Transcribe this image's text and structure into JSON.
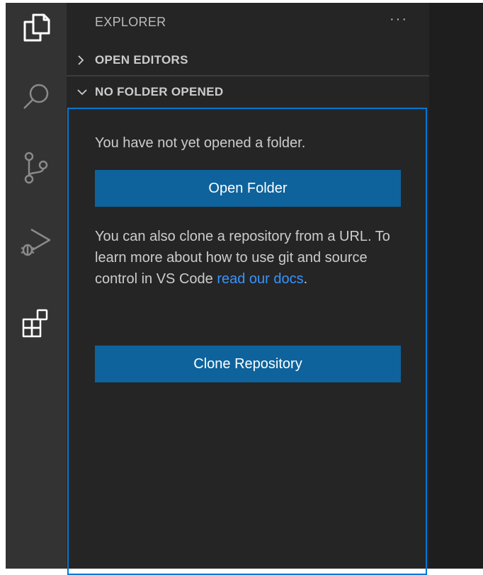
{
  "activity_bar": {
    "icons": [
      "explorer-icon",
      "search-icon",
      "source-control-icon",
      "run-debug-icon",
      "extensions-icon"
    ]
  },
  "sidebar": {
    "title": "EXPLORER",
    "more_actions": "···",
    "sections": [
      {
        "label": "OPEN EDITORS",
        "expanded": false
      },
      {
        "label": "NO FOLDER OPENED",
        "expanded": true
      }
    ]
  },
  "welcome": {
    "message": "You have not yet opened a folder.",
    "open_folder_button": "Open Folder",
    "clone_text_before": "You can also clone a repository from a URL. To learn more about how to use git and source control in VS Code ",
    "clone_link": "read our docs",
    "clone_text_after": ".",
    "clone_button": "Clone Repository"
  },
  "colors": {
    "activity_bar": "#333333",
    "sidebar": "#252526",
    "button": "#0e639c",
    "focus_border": "#0078d4",
    "link": "#3794ff"
  }
}
